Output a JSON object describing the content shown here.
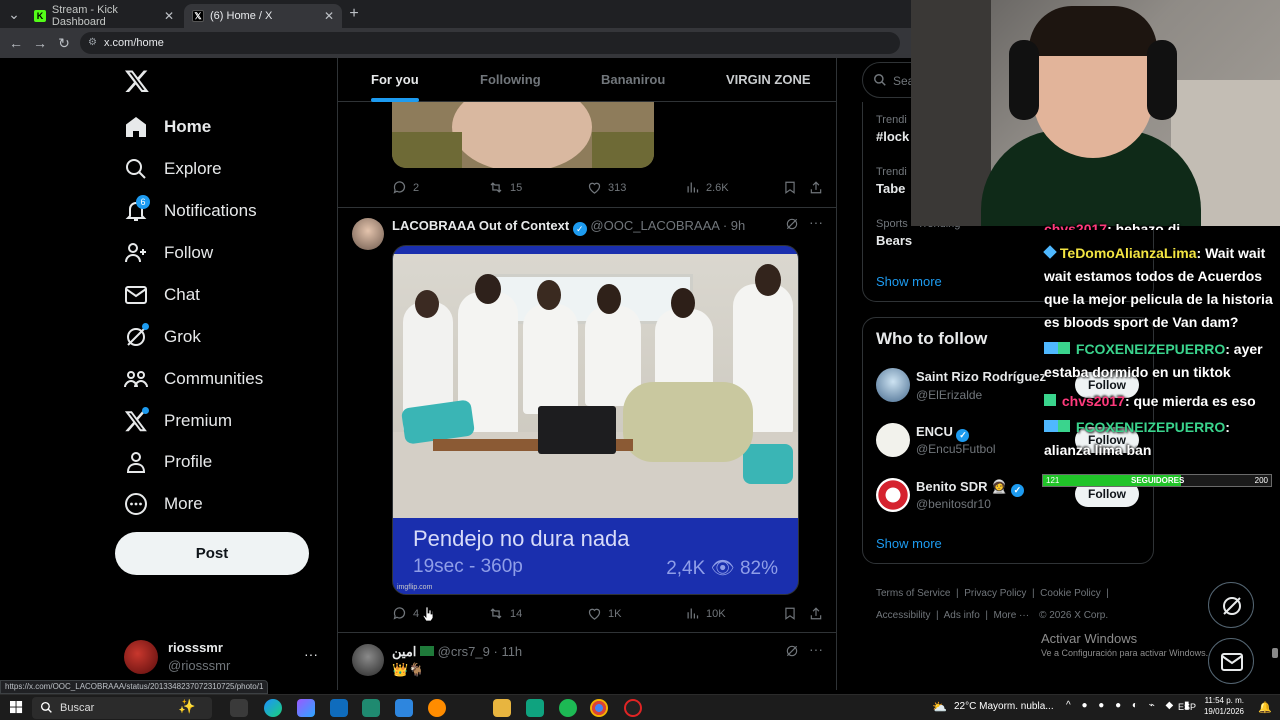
{
  "browser": {
    "tabs": [
      {
        "label": "Stream - Kick Dashboard",
        "favicon": "kick-icon"
      },
      {
        "label": "(6) Home / X",
        "favicon": "x-icon"
      }
    ],
    "url": "x.com/home",
    "status_url": "https://x.com/OOC_LACOBRAAA/status/2013348237072310725/photo/1"
  },
  "sidebar": {
    "items": [
      {
        "label": "Home",
        "icon": "home-icon"
      },
      {
        "label": "Explore",
        "icon": "search-icon"
      },
      {
        "label": "Notifications",
        "icon": "bell-icon",
        "badge": "6"
      },
      {
        "label": "Follow",
        "icon": "person-add-icon"
      },
      {
        "label": "Chat",
        "icon": "mail-icon"
      },
      {
        "label": "Grok",
        "icon": "grok-icon"
      },
      {
        "label": "Communities",
        "icon": "communities-icon"
      },
      {
        "label": "Premium",
        "icon": "x-premium-icon"
      },
      {
        "label": "Profile",
        "icon": "person-icon"
      },
      {
        "label": "More",
        "icon": "more-circle-icon"
      }
    ],
    "post_label": "Post",
    "account": {
      "name": "riosssmr",
      "handle": "@riosssmr"
    }
  },
  "feed": {
    "tabs": [
      "For you",
      "Following",
      "Bananirou",
      "VIRGIN ZONE"
    ],
    "prev_post_actions": {
      "replies": "2",
      "reposts": "15",
      "likes": "313",
      "views": "2.6K"
    },
    "post": {
      "author": "LACOBRAAA Out of Context",
      "handle": "@OOC_LACOBRAAA",
      "time": "· 9h",
      "meme_caption": "Pendejo no dura nada",
      "meme_stats_left": "19sec - 360p",
      "meme_stats_right": "2,4K  👁  82%",
      "watermark": "imgflip.com",
      "actions": {
        "replies": "4",
        "reposts": "14",
        "likes": "1K",
        "views": "10K"
      }
    },
    "next_post": {
      "author": "امين",
      "handle": "@crs7_9",
      "time": "· 11h",
      "text": "👑🐐"
    }
  },
  "right": {
    "search_placeholder": "Sea",
    "trends": [
      {
        "meta": "Trendi",
        "title": "#lock"
      },
      {
        "meta": "Trendi",
        "title": "Tabe"
      },
      {
        "meta": "Sports · Trending",
        "title": "Bears"
      }
    ],
    "show_more": "Show more",
    "who_to_follow": {
      "title": "Who to follow",
      "accounts": [
        {
          "name": "Saint Rizo Rodríguez",
          "handle": "@ElErizalde",
          "button": "Follow"
        },
        {
          "name": "ENCU",
          "handle": "@Encu5Futbol",
          "button": "Follow"
        },
        {
          "name": "Benito SDR 🧑‍🚀",
          "handle": "@benitosdr10",
          "button": "Follow"
        }
      ],
      "show_more": "Show more"
    },
    "footer": [
      "Terms of Service",
      "Privacy Policy",
      "Cookie Policy",
      "Accessibility",
      "Ads info",
      "More ···",
      "© 2026 X Corp."
    ],
    "windows_activation": {
      "title": "Activar Windows",
      "subtitle": "Ve a Configuración para activar Windows."
    }
  },
  "chat": {
    "lines": [
      {
        "user": "chvs2017",
        "text": ": hehazo di"
      },
      {
        "user": "TeDomoAlianzaLima",
        "text": ": Wait wait wait estamos todos de Acuerdos que la mejor pelicula de la historia es bloods sport de Van dam?"
      },
      {
        "user": "FCOXENEIZEPUERRO",
        "text": ": ayer estaba dormido en un tiktok"
      },
      {
        "user": "chvs2017",
        "text": ": que mierda es eso"
      },
      {
        "user": "FCOXENEIZEPUERRO",
        "text": ": alianza lima ban"
      }
    ],
    "goal_bar": {
      "current": "121",
      "label": "SEGUIDORES",
      "target": "200",
      "progress": 0.605
    }
  },
  "taskbar": {
    "search": "Buscar",
    "weather": "22°C  Mayorm. nubla...",
    "lang": "ESP",
    "time": "11:54 p. m.",
    "date": "19/01/2026"
  }
}
